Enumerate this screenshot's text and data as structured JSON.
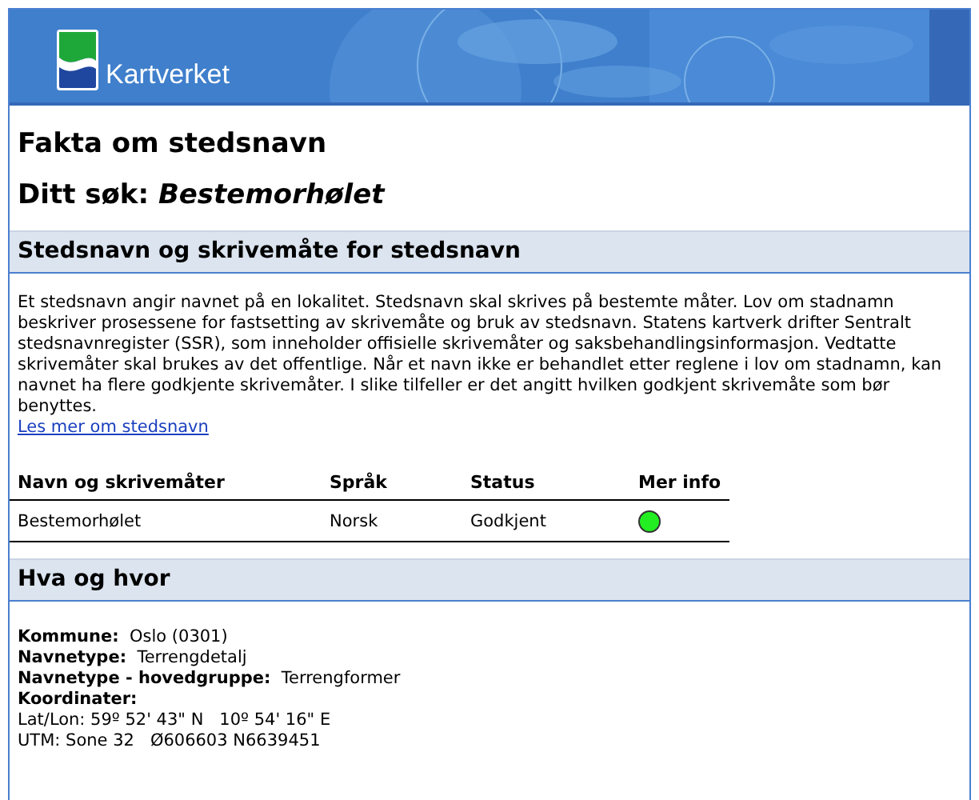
{
  "header": {
    "logo_text": "Kartverket"
  },
  "page_title": "Fakta om stedsnavn",
  "search": {
    "label": "Ditt søk:",
    "query": "Bestemorhølet"
  },
  "sections": [
    {
      "title": "Stedsnavn og skrivemåte for stedsnavn",
      "kind": "names",
      "paragraph": "Et stedsnavn angir navnet på en lokalitet. Stedsnavn skal skrives på bestemte måter. Lov om stadnamn beskriver prosessene for fastsetting av skrivemåte og bruk av stedsnavn. Statens kartverk drifter Sentralt stedsnavnregister (SSR), som inneholder offisielle skrivemåter og saksbehandlingsinformasjon. Vedtatte skrivemåter skal brukes av det offentlige. Når et navn ikke er behandlet etter reglene i lov om stadnamn, kan navnet ha flere godkjente skrivemåter. I slike tilfeller er det angitt hvilken godkjent skrivemåte som bør benyttes.",
      "link": "Les mer om stedsnavn",
      "table": {
        "columns": [
          "Navn og skrivemåter",
          "Språk",
          "Status",
          "Mer info"
        ],
        "rows": [
          {
            "name": "Bestemorhølet",
            "language": "Norsk",
            "status": "Godkjent",
            "color": "#22ee22"
          }
        ]
      }
    },
    {
      "title": "Hva og hvor",
      "kind": "facts",
      "facts": [
        {
          "label": "Kommune:",
          "value": "Oslo (0301)"
        },
        {
          "label": "Navnetype:",
          "value": "Terrengdetalj"
        },
        {
          "label": "Navnetype - hovedgruppe:",
          "value": "Terrengformer"
        },
        {
          "label": "Koordinater:"
        }
      ],
      "coordinates": [
        "Lat/Lon: 59º 52' 43\" N   10º 54' 16\" E",
        "UTM: Sone 32   Ø606603 N6639451"
      ]
    }
  ]
}
